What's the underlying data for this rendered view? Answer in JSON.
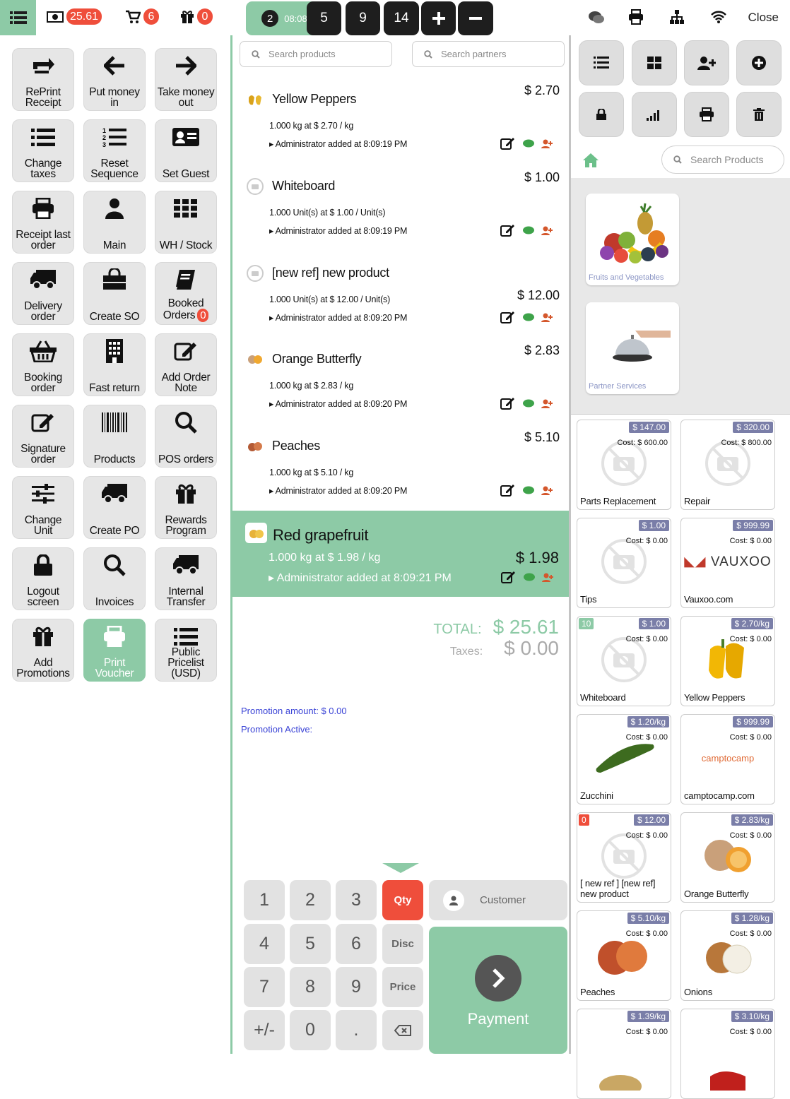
{
  "topbar": {
    "cash_total": "25.61",
    "cart_count": "6",
    "gift_count": "0",
    "orders": [
      {
        "label": "08:08",
        "num": "2",
        "active": true
      },
      {
        "label": "5"
      },
      {
        "label": "9"
      },
      {
        "label": "14"
      }
    ],
    "close_label": "Close"
  },
  "actions": [
    {
      "label": "RePrint Receipt",
      "icon": "reprint-icon"
    },
    {
      "label": "Put money in",
      "icon": "arrow-left-icon"
    },
    {
      "label": "Take money out",
      "icon": "arrow-right-icon"
    },
    {
      "label": "Change taxes",
      "icon": "list-icon"
    },
    {
      "label": "Reset Sequence",
      "icon": "ordered-list-icon"
    },
    {
      "label": "Set Guest",
      "icon": "id-card-icon"
    },
    {
      "label": "Receipt last order",
      "icon": "printer-icon"
    },
    {
      "label": "Main",
      "icon": "user-icon"
    },
    {
      "label": "WH / Stock",
      "icon": "grid-icon"
    },
    {
      "label": "Delivery order",
      "icon": "truck-icon"
    },
    {
      "label": "Create SO",
      "icon": "shopping-bag-icon"
    },
    {
      "label": "Booked Orders",
      "icon": "book-icon",
      "badge": "0"
    },
    {
      "label": "Booking order",
      "icon": "basket-icon"
    },
    {
      "label": "Fast return",
      "icon": "building-icon"
    },
    {
      "label": "Add Order Note",
      "icon": "edit-icon"
    },
    {
      "label": "Signature order",
      "icon": "signature-icon"
    },
    {
      "label": "Products",
      "icon": "barcode-icon"
    },
    {
      "label": "POS orders",
      "icon": "search-icon"
    },
    {
      "label": "Change Unit",
      "icon": "sliders-icon"
    },
    {
      "label": "Create PO",
      "icon": "truck-icon"
    },
    {
      "label": "Rewards Program",
      "icon": "gift-icon"
    },
    {
      "label": "Logout screen",
      "icon": "lock-icon"
    },
    {
      "label": "Invoices",
      "icon": "search-icon"
    },
    {
      "label": "Internal Transfer",
      "icon": "truck-icon"
    },
    {
      "label": "Add Promotions",
      "icon": "gift-icon"
    },
    {
      "label": "Print Voucher",
      "icon": "printer-icon",
      "active": true
    },
    {
      "label": "Public Pricelist (USD)",
      "icon": "list-icon"
    }
  ],
  "search": {
    "products_placeholder": "Search products",
    "partners_placeholder": "Search partners",
    "right_placeholder": "Search Products"
  },
  "order_lines": [
    {
      "name": "Yellow Peppers",
      "price": "$ 2.70",
      "qty": "1.000 kg at $ 2.70 / kg",
      "added": "Administrator added at 8:09:19 PM"
    },
    {
      "name": "Whiteboard",
      "price": "$ 1.00",
      "qty": "1.000 Unit(s) at $ 1.00 / Unit(s)",
      "added": "Administrator added at 8:09:19 PM"
    },
    {
      "name": "[new ref] new product",
      "price": "$ 12.00",
      "qty": "1.000 Unit(s) at $ 12.00 / Unit(s)",
      "added": "Administrator added at 8:09:20 PM"
    },
    {
      "name": "Orange Butterfly",
      "price": "$ 2.83",
      "qty": "1.000 kg at $ 2.83 / kg",
      "added": "Administrator added at 8:09:20 PM"
    },
    {
      "name": "Peaches",
      "price": "$ 5.10",
      "qty": "1.000 kg at $ 5.10 / kg",
      "added": "Administrator added at 8:09:20 PM"
    }
  ],
  "selected_line": {
    "name": "Red grapefruit",
    "price": "$ 1.98",
    "qty": "1.000 kg at $ 1.98 / kg",
    "added": "Administrator added at 8:09:21 PM"
  },
  "totals": {
    "total_label": "TOTAL:",
    "total_value": "$ 25.61",
    "taxes_label": "Taxes:",
    "taxes_value": "$ 0.00"
  },
  "promotion": {
    "amount": "Promotion amount: $ 0.00",
    "active": "Promotion Active:"
  },
  "keypad": {
    "digits": [
      "1",
      "2",
      "3",
      "4",
      "5",
      "6",
      "7",
      "8",
      "9",
      "+/-",
      "0",
      "."
    ],
    "modes": [
      "Qty",
      "Disc",
      "Price"
    ],
    "customer_label": "Customer",
    "payment_label": "Payment"
  },
  "categories": [
    {
      "name": "Fruits and Vegetables"
    },
    {
      "name": "Partner Services"
    }
  ],
  "products": [
    {
      "name": "Parts Replacement",
      "price": "$ 147.00",
      "cost": "Cost: $ 600.00"
    },
    {
      "name": "Repair",
      "price": "$ 320.00",
      "cost": "Cost: $ 800.00"
    },
    {
      "name": "Tips",
      "price": "$ 1.00",
      "cost": "Cost: $ 0.00"
    },
    {
      "name": "Vauxoo.com",
      "price": "$ 999.99",
      "cost": "Cost: $ 0.00",
      "logo": "VAUXOO"
    },
    {
      "name": "Whiteboard",
      "price": "$ 1.00",
      "cost": "Cost: $ 0.00",
      "qty_badge": "10",
      "qty_color": "#8dcaa6"
    },
    {
      "name": "Yellow Peppers",
      "price": "$ 2.70/kg",
      "cost": "Cost: $ 0.00"
    },
    {
      "name": "Zucchini",
      "price": "$ 1.20/kg",
      "cost": "Cost: $ 0.00"
    },
    {
      "name": "camptocamp.com",
      "price": "$ 999.99",
      "cost": "Cost: $ 0.00",
      "logo": "camptocamp"
    },
    {
      "name": "[ new ref ] [new ref] new product",
      "price": "$ 12.00",
      "cost": "Cost: $ 0.00",
      "qty_badge": "0",
      "qty_color": "#ef4e3b"
    },
    {
      "name": "Orange Butterfly",
      "price": "$ 2.83/kg",
      "cost": "Cost: $ 0.00"
    },
    {
      "name": "Peaches",
      "price": "$ 5.10/kg",
      "cost": "Cost: $ 0.00"
    },
    {
      "name": "Onions",
      "price": "$ 1.28/kg",
      "cost": "Cost: $ 0.00"
    },
    {
      "name": "",
      "price": "$ 1.39/kg",
      "cost": "Cost: $ 0.00"
    },
    {
      "name": "",
      "price": "$ 3.10/kg",
      "cost": "Cost: $ 0.00"
    }
  ],
  "colors": {
    "accent": "#8dcaa6",
    "alert": "#ef4e3b",
    "dark": "#1e1e1e",
    "tag": "#7a7ea8"
  }
}
